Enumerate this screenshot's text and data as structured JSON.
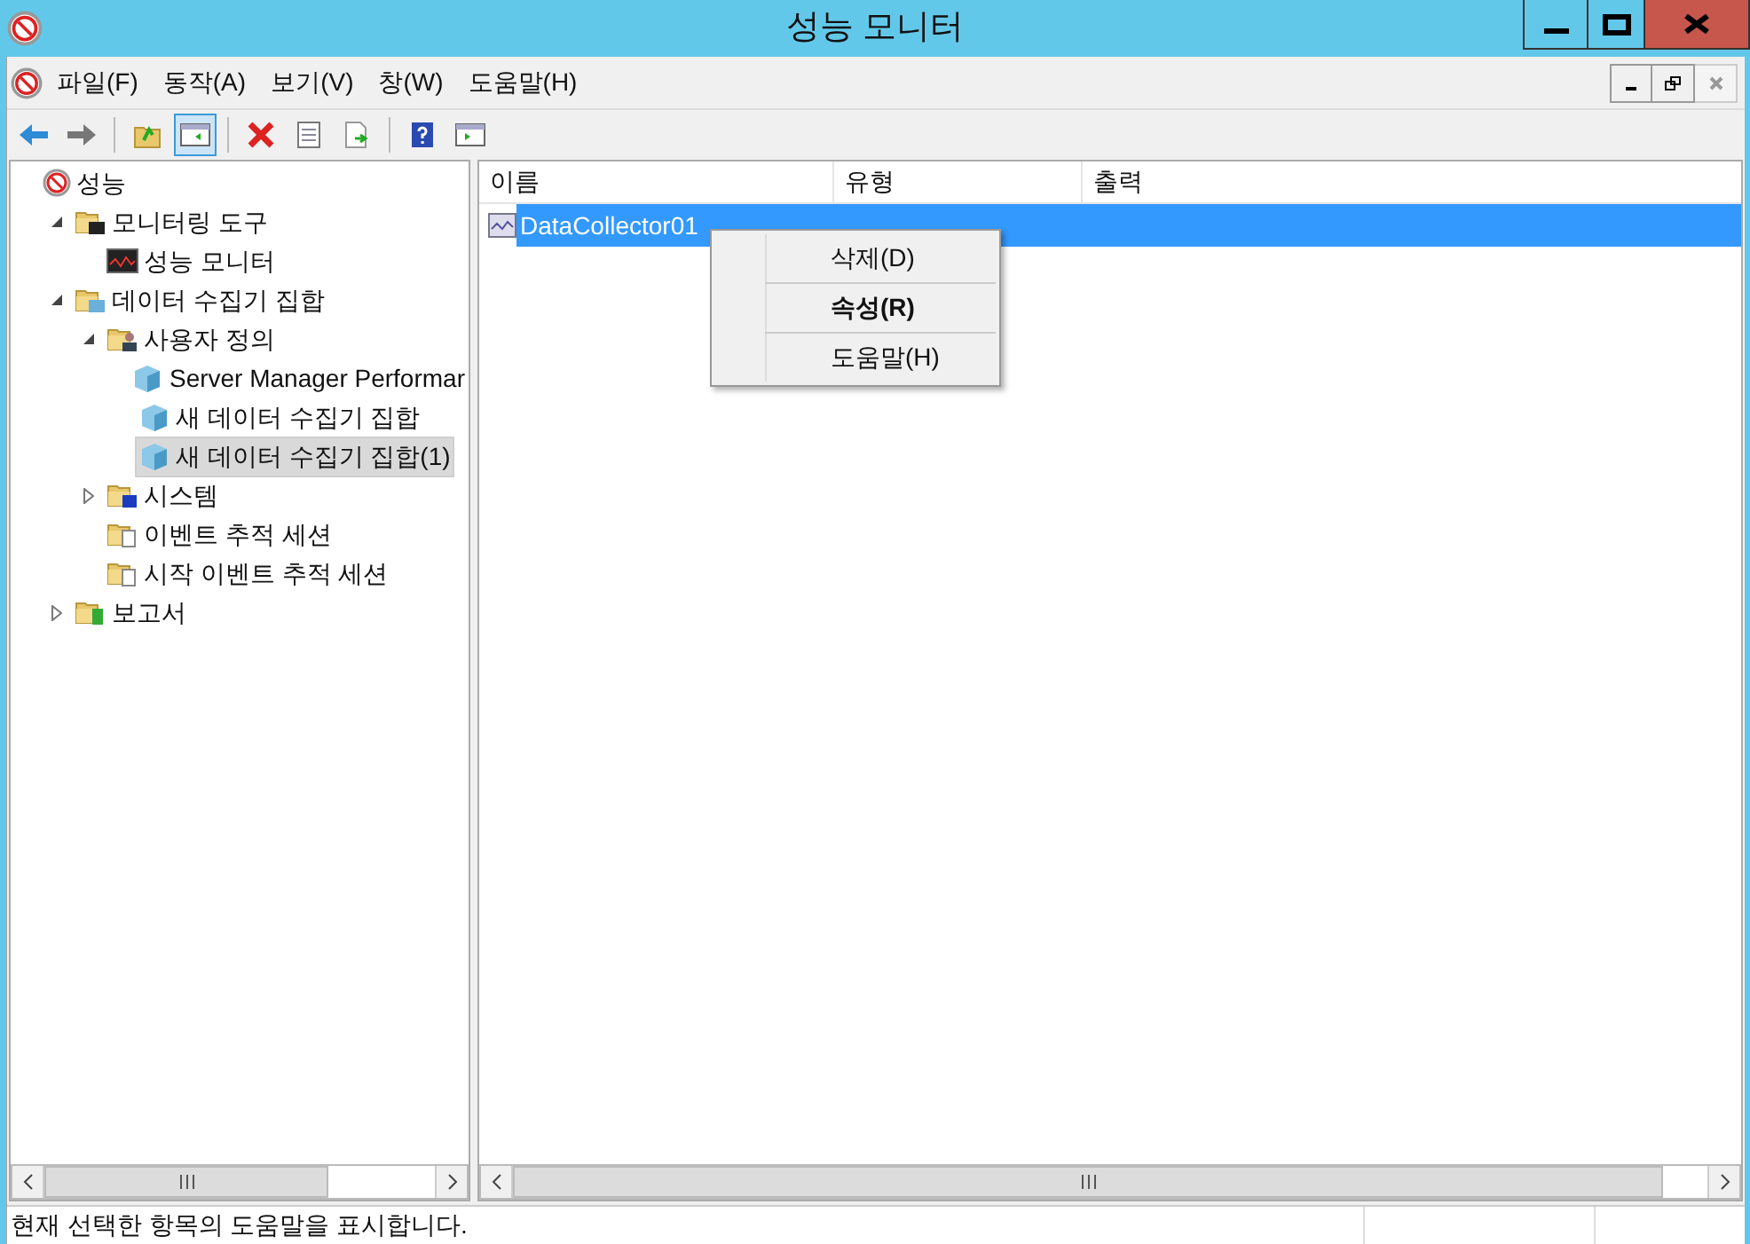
{
  "window": {
    "title": "성능 모니터"
  },
  "menu": [
    "파일(F)",
    "동작(A)",
    "보기(V)",
    "창(W)",
    "도움말(H)"
  ],
  "toolbar": [
    [
      {
        "kind": "back",
        "selected": false
      },
      {
        "kind": "forward",
        "selected": false
      }
    ],
    [
      {
        "kind": "folder-up",
        "selected": false
      },
      {
        "kind": "panel",
        "selected": true
      }
    ],
    [
      {
        "kind": "delete",
        "selected": false
      },
      {
        "kind": "props",
        "selected": false
      },
      {
        "kind": "export",
        "selected": false
      }
    ],
    [
      {
        "kind": "help",
        "selected": false
      },
      {
        "kind": "panel2",
        "selected": false
      }
    ]
  ],
  "tree": [
    {
      "label": "성능",
      "kind": "perf",
      "selected": false,
      "children": [
        {
          "label": "모니터링 도구",
          "kind": "folder-mon",
          "expanded": true,
          "selected": false,
          "children": [
            {
              "label": "성능 모니터",
              "kind": "chart",
              "selected": false
            }
          ]
        },
        {
          "label": "데이터 수집기 집합",
          "kind": "folder-data",
          "expanded": true,
          "selected": false,
          "children": [
            {
              "label": "사용자 정의",
              "kind": "folder-user",
              "expanded": true,
              "selected": false,
              "children": [
                {
                  "label": "Server Manager Performar",
                  "kind": "cube",
                  "selected": false
                },
                {
                  "label": "새 데이터 수집기 집합",
                  "kind": "cube",
                  "selected": false
                },
                {
                  "label": "새 데이터 수집기 집합(1)",
                  "kind": "cube",
                  "selected": true
                }
              ]
            },
            {
              "label": "시스템",
              "kind": "folder-sys",
              "expanded": false,
              "selected": false
            },
            {
              "label": "이벤트 추적 세션",
              "kind": "folder-doc",
              "selected": false
            },
            {
              "label": "시작 이벤트 추적 세션",
              "kind": "folder-doc",
              "selected": false
            }
          ]
        },
        {
          "label": "보고서",
          "kind": "folder-report",
          "expanded": false,
          "selected": false
        }
      ]
    }
  ],
  "list": {
    "columns": [
      "이름",
      "유형",
      "출력"
    ],
    "rows": [
      {
        "name": "DataCollector01",
        "selected": true
      }
    ]
  },
  "context_menu": [
    {
      "label": "삭제(D)",
      "bold": false
    },
    {
      "label": "속성(R)",
      "bold": true
    },
    {
      "label": "도움말(H)",
      "bold": false
    }
  ],
  "status_bar": "현재 선택한 항목의 도움말을 표시합니다."
}
